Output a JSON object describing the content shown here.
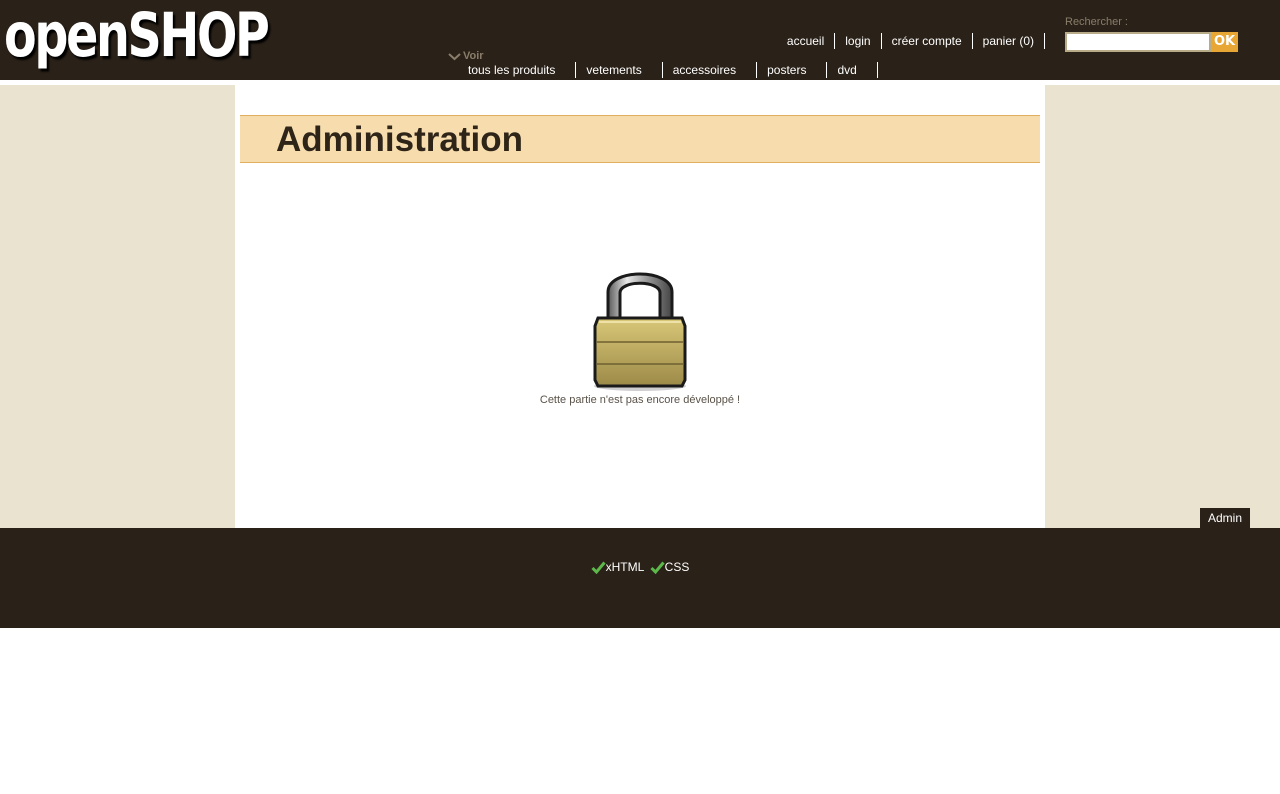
{
  "header": {
    "logo_text": "openSHOP",
    "top_nav": [
      "accueil",
      "login",
      "créer compte",
      "panier (0)"
    ],
    "search": {
      "label": "Rechercher :",
      "placeholder": "",
      "button_label": "OK"
    },
    "voir_label": "Voir",
    "category_nav": [
      "tous les produits",
      "vetements",
      "accessoires",
      "posters",
      "dvd"
    ]
  },
  "main": {
    "title": "Administration",
    "notice": "Cette partie n'est pas encore développé !",
    "lock_icon": "padlock-icon"
  },
  "admin_button": "Admin",
  "footer": {
    "validators": [
      "xHTML",
      "CSS"
    ],
    "check_icon": "checkmark-icon"
  },
  "colors": {
    "header_bg": "#2a2118",
    "side_bg": "#e9e3cf",
    "title_bar_bg": "#f7ddae",
    "title_border": "#e0b060",
    "accent": "#e8a634",
    "check_green": "#5cb84a"
  }
}
